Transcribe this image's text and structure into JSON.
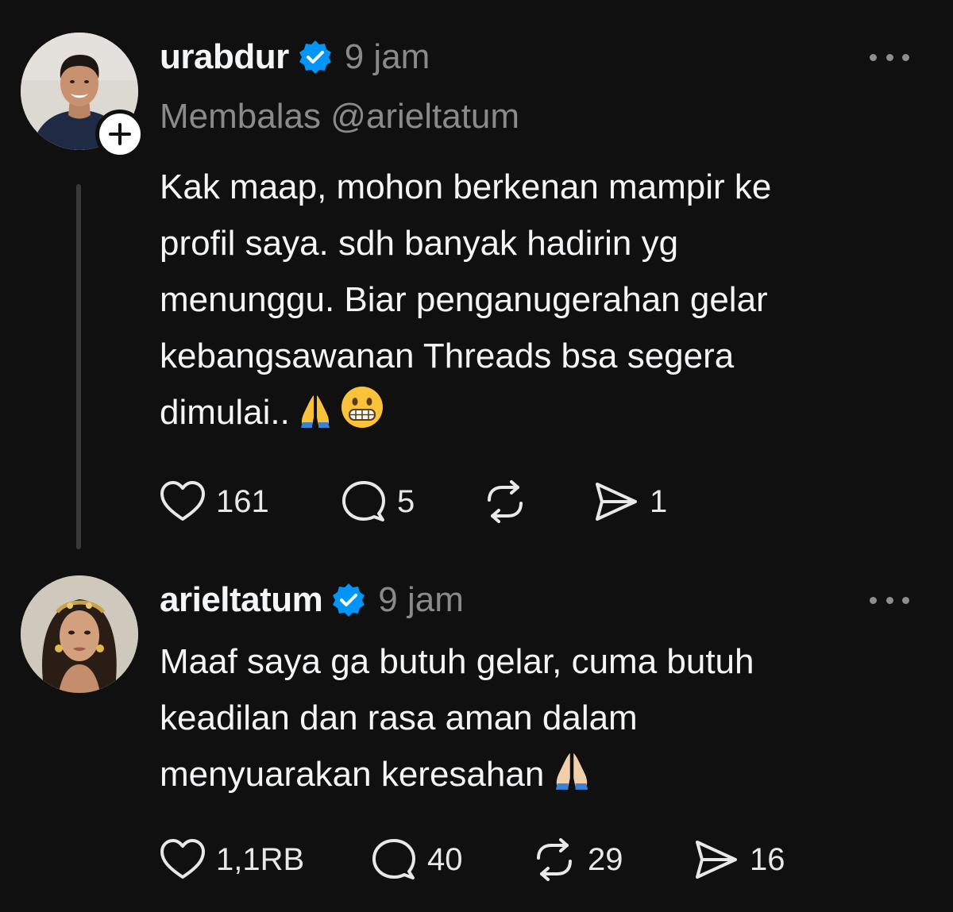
{
  "posts": [
    {
      "username": "urabdur",
      "verified": true,
      "timestamp": "9 jam",
      "reply_to": "Membalas @arieltatum",
      "body": "Kak maap, mohon berkenan mampir ke profil saya. sdh banyak hadirin yg menunggu. Biar penganugerahan gelar kebangsawanan Threads bsa segera dimulai..",
      "body_lines": [
        "Kak maap, mohon berkenan mampir ke",
        "profil saya. sdh banyak hadirin yg",
        "menunggu. Biar penganugerahan gelar",
        "kebangsawanan Threads bsa segera",
        "dimulai.."
      ],
      "emojis": [
        "folded-hands",
        "grinning-face"
      ],
      "likes": "161",
      "replies": "5",
      "reposts": "",
      "shares": "1"
    },
    {
      "username": "arieltatum",
      "verified": true,
      "timestamp": "9 jam",
      "body_lines": [
        "Maaf saya ga butuh gelar, cuma butuh",
        "keadilan dan rasa aman dalam",
        "menyuarakan keresahan"
      ],
      "emojis": [
        "folded-hands-light-skin"
      ],
      "likes": "1,1RB",
      "replies": "40",
      "reposts": "29",
      "shares": "16"
    }
  ],
  "colors": {
    "background": "#101010",
    "text_primary": "#f3f5f7",
    "text_secondary": "#8a8a8a",
    "verified_blue": "#0095f6",
    "thread_line": "#3a3a3a"
  },
  "icons": {
    "like": "heart-icon",
    "reply": "comment-bubble-icon",
    "repost": "repost-arrows-icon",
    "share": "send-icon",
    "more": "more-dots-icon",
    "verified": "verified-badge-icon",
    "follow": "plus-icon"
  }
}
